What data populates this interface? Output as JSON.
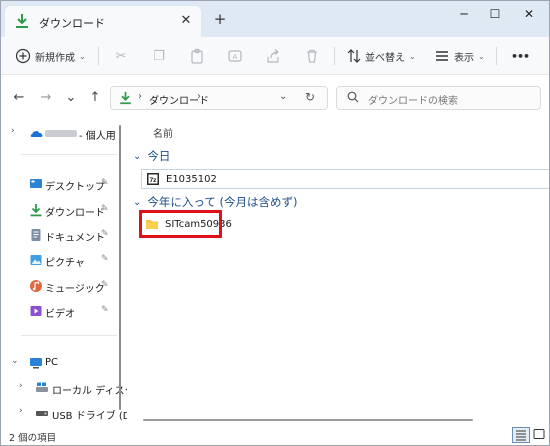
{
  "window": {
    "tab_title": "ダウンロード",
    "tab_close": "✕",
    "tab_add": "+",
    "minimize": "─",
    "maximize": "☐",
    "close": "✕"
  },
  "toolbar": {
    "new_label": "新規作成",
    "sort_label": "並べ替え",
    "view_label": "表示",
    "more_label": "•••",
    "icons": [
      "cut-icon",
      "copy-icon",
      "paste-icon",
      "rename-icon",
      "share-icon",
      "delete-icon"
    ]
  },
  "nav": {
    "back": "←",
    "forward": "→",
    "recent": "⌄",
    "up": "↑"
  },
  "address": {
    "crumb": "ダウンロード",
    "sep": "›"
  },
  "search": {
    "placeholder": "ダウンロードの検索"
  },
  "sidebar": {
    "onedrive": "- 個人用",
    "quick": [
      {
        "label": "デスクトップ",
        "icon": "desktop-icon"
      },
      {
        "label": "ダウンロード",
        "icon": "download-icon"
      },
      {
        "label": "ドキュメント",
        "icon": "document-icon"
      },
      {
        "label": "ピクチャ",
        "icon": "pictures-icon"
      },
      {
        "label": "ミュージック",
        "icon": "music-icon"
      },
      {
        "label": "ビデオ",
        "icon": "video-icon"
      }
    ],
    "pin": "📌",
    "pc": "PC",
    "drives": [
      {
        "label": "ローカル ディスク"
      },
      {
        "label": "USB ドライブ (D:"
      }
    ]
  },
  "main": {
    "column_name": "名前",
    "groups": [
      {
        "label": "今日",
        "files": [
          {
            "name": "E1035102",
            "icon": "executable-icon"
          }
        ]
      },
      {
        "label": "今年に入って (今月は含めず)",
        "files": [
          {
            "name": "SITcam50936",
            "icon": "folder-icon"
          }
        ]
      }
    ]
  },
  "status": {
    "count": "2 個の項目"
  },
  "colors": {
    "accent": "#1f4e8c",
    "tabbar": "#dfe9f3",
    "highlight": "#e0101a",
    "folder": "#f5c342",
    "download_green": "#2e9a4a"
  }
}
